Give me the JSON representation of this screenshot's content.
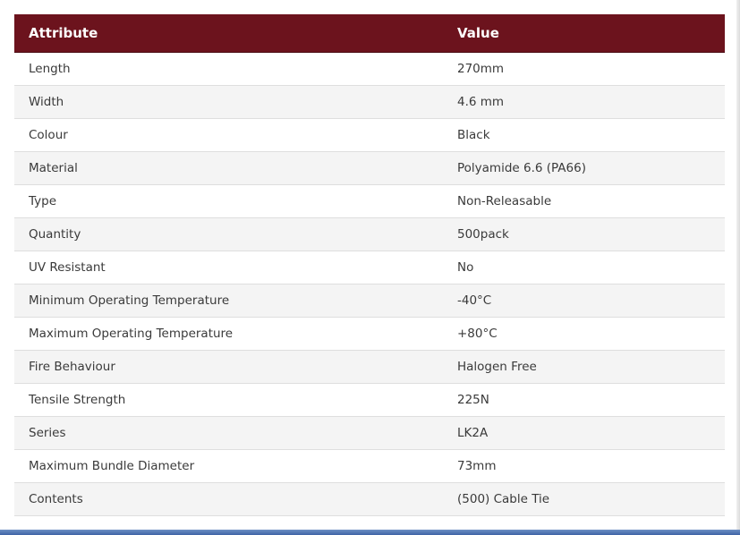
{
  "table": {
    "headers": {
      "attribute": "Attribute",
      "value": "Value"
    },
    "rows": [
      {
        "attribute": "Length",
        "value": "270mm"
      },
      {
        "attribute": "Width",
        "value": "4.6 mm"
      },
      {
        "attribute": "Colour",
        "value": "Black"
      },
      {
        "attribute": "Material",
        "value": "Polyamide 6.6 (PA66)"
      },
      {
        "attribute": "Type",
        "value": "Non-Releasable"
      },
      {
        "attribute": "Quantity",
        "value": "500pack"
      },
      {
        "attribute": "UV Resistant",
        "value": "No"
      },
      {
        "attribute": "Minimum Operating Temperature",
        "value": "-40°C"
      },
      {
        "attribute": "Maximum Operating Temperature",
        "value": "+80°C"
      },
      {
        "attribute": "Fire Behaviour",
        "value": "Halogen Free"
      },
      {
        "attribute": "Tensile Strength",
        "value": "225N"
      },
      {
        "attribute": "Series",
        "value": "LK2A"
      },
      {
        "attribute": "Maximum Bundle Diameter",
        "value": "73mm"
      },
      {
        "attribute": "Contents",
        "value": "(500) Cable Tie"
      }
    ]
  },
  "colors": {
    "header_background": "#6c131d",
    "header_text": "#ffffff",
    "row_alt_background": "#f4f4f4",
    "bottom_bar": "#3e63a6"
  }
}
